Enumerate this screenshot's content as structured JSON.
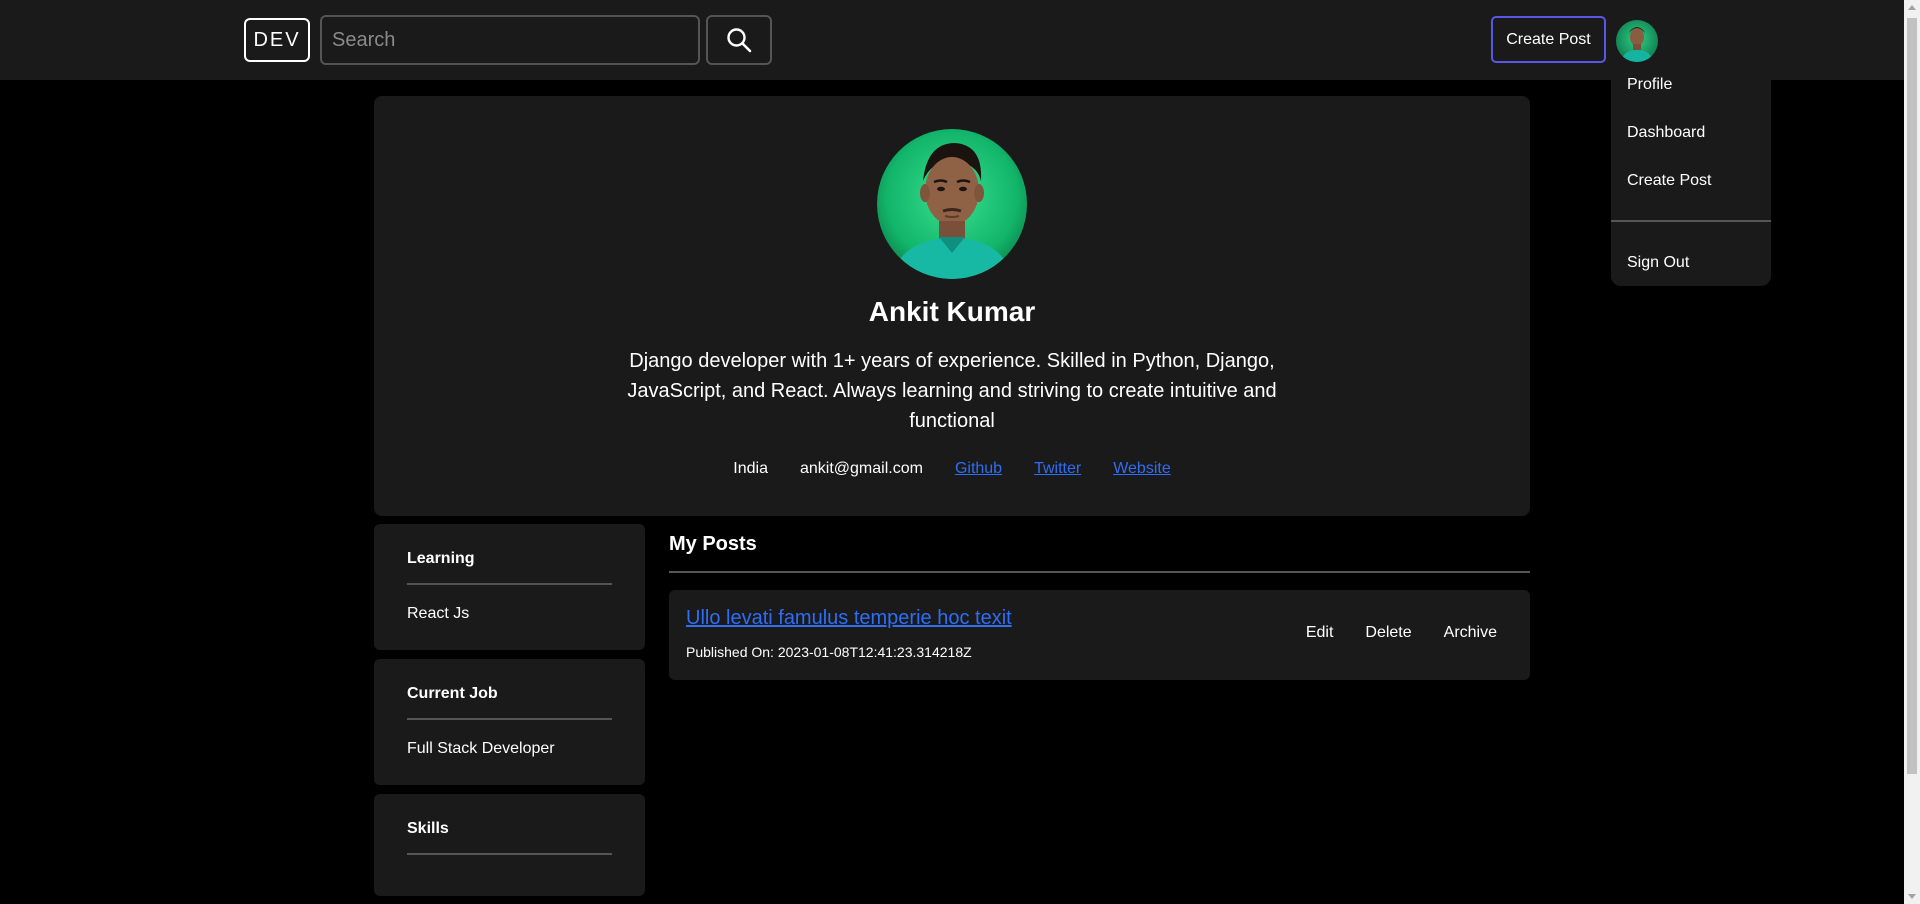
{
  "navbar": {
    "logo": "DEV",
    "search_placeholder": "Search",
    "create_post_label": "Create Post"
  },
  "dropdown": {
    "items": [
      "Profile",
      "Dashboard",
      "Create Post"
    ],
    "sign_out": "Sign Out"
  },
  "profile": {
    "name": "Ankit Kumar",
    "bio": "Django developer with 1+ years of experience. Skilled in Python, Django, JavaScript, and React. Always learning and striving to create intuitive and functional",
    "location": "India",
    "email": "ankit@gmail.com",
    "links": [
      "Github",
      "Twitter",
      "Website"
    ]
  },
  "sidebar": {
    "learning": {
      "title": "Learning",
      "value": "React Js"
    },
    "current_job": {
      "title": "Current Job",
      "value": "Full Stack Developer"
    },
    "skills": {
      "title": "Skills",
      "value": ""
    }
  },
  "posts": {
    "heading": "My Posts",
    "items": [
      {
        "title": "Ullo levati famulus temperie hoc texit",
        "published": "Published On: 2023-01-08T12:41:23.314218Z",
        "actions": [
          "Edit",
          "Delete",
          "Archive"
        ]
      }
    ]
  },
  "colors": {
    "page_bg": "#000000",
    "surface": "#1a1a1a",
    "accent_border": "#5a57e8",
    "link": "#2f6df6",
    "divider": "#555555"
  },
  "icons": {
    "search": "search-icon",
    "avatar": "avatar"
  }
}
